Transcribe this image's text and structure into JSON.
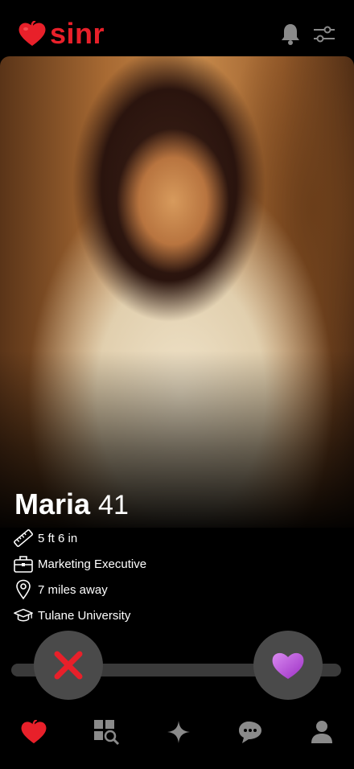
{
  "app": {
    "brand": "sinr",
    "brand_color": "#e8202a"
  },
  "header": {
    "icons": [
      "bell-icon",
      "filter-sliders-icon"
    ]
  },
  "profile": {
    "name": "Maria",
    "age": "41",
    "details": [
      {
        "icon": "ruler-icon",
        "text": "5 ft 6 in"
      },
      {
        "icon": "briefcase-icon",
        "text": "Marketing Executive"
      },
      {
        "icon": "location-pin-icon",
        "text": "7 miles away"
      },
      {
        "icon": "graduation-cap-icon",
        "text": "Tulane University"
      }
    ]
  },
  "actions": {
    "dislike_icon": "x-icon",
    "like_icon": "heart-icon",
    "like_color": "#b24bd6",
    "dislike_color": "#e8202a"
  },
  "nav": {
    "items": [
      "heart-icon",
      "browse-search-icon",
      "sparkle-icon",
      "chat-bubbles-icon",
      "profile-icon"
    ],
    "active_index": 0
  }
}
